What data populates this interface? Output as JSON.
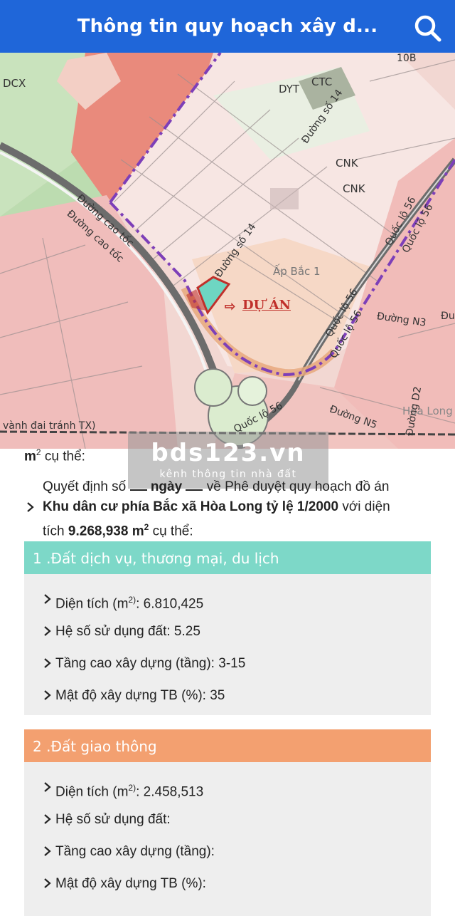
{
  "header": {
    "title": "Thông tin quy hoạch xây d..."
  },
  "map": {
    "labels": [
      "DCX",
      "DYT",
      "CTC",
      "CNK",
      "CNK",
      "Ấp Bắc 1",
      "Hòa Long"
    ],
    "roads": [
      "Đường cao tốc",
      "Đường cao tốc",
      "Đường số 14",
      "Đường số 14",
      "Quốc lộ 56",
      "Quốc lộ 56",
      "Quốc lộ 56",
      "Quốc lộ 56",
      "Quốc lộ 56",
      "Đường N3",
      "Đường N5",
      "Đường D2",
      "vành đai tránh TX)",
      "10B",
      "Đu"
    ],
    "project_label": "DỰ ÁN",
    "project_arrow": "⇨"
  },
  "watermark": {
    "main": "bds123.vn",
    "sub": "kênh thông tin nhà đất"
  },
  "partial_line": {
    "unit": "m",
    "text": "cụ thể:"
  },
  "intro": {
    "line1_prefix": "Quyết định số",
    "line1_blank1": "",
    "line1_mid": "ngày",
    "line1_blank2": "",
    "line1_suffix": "về Phê duyệt quy hoạch đồ án",
    "line2_bold": "Khu dân cư phía Bắc xã Hòa Long tỷ lệ 1/2000",
    "line2_suffix": "với diện",
    "line3_prefix": "tích",
    "area_bold": "9.268,938 m",
    "line3_suffix": "cụ thể:"
  },
  "sections": [
    {
      "heading": "1 .Đất dịch vụ, thương mại, du lịch",
      "color": "#7dd8c8",
      "rows": [
        {
          "label": "Diện tích (m",
          "sup": "2)",
          "value": ": 6.810,425"
        },
        {
          "label": "Hệ số sử dụng đất:",
          "value": " 5.25"
        },
        {
          "label": "Tầng cao xây dựng (tầng):",
          "value": " 3-15"
        },
        {
          "label": "Mật độ xây dựng TB (%):",
          "value": " 35"
        }
      ]
    },
    {
      "heading": "2 .Đất giao thông",
      "color": "#f3a070",
      "rows": [
        {
          "label": "Diện tích (m",
          "sup": "2)",
          "value": ": 2.458,513"
        },
        {
          "label": "Hệ số sử dụng đất:",
          "value": ""
        },
        {
          "label": "Tầng cao xây dựng (tầng):",
          "value": ""
        },
        {
          "label": "Mật độ xây dựng TB (%):",
          "value": ""
        }
      ]
    }
  ]
}
